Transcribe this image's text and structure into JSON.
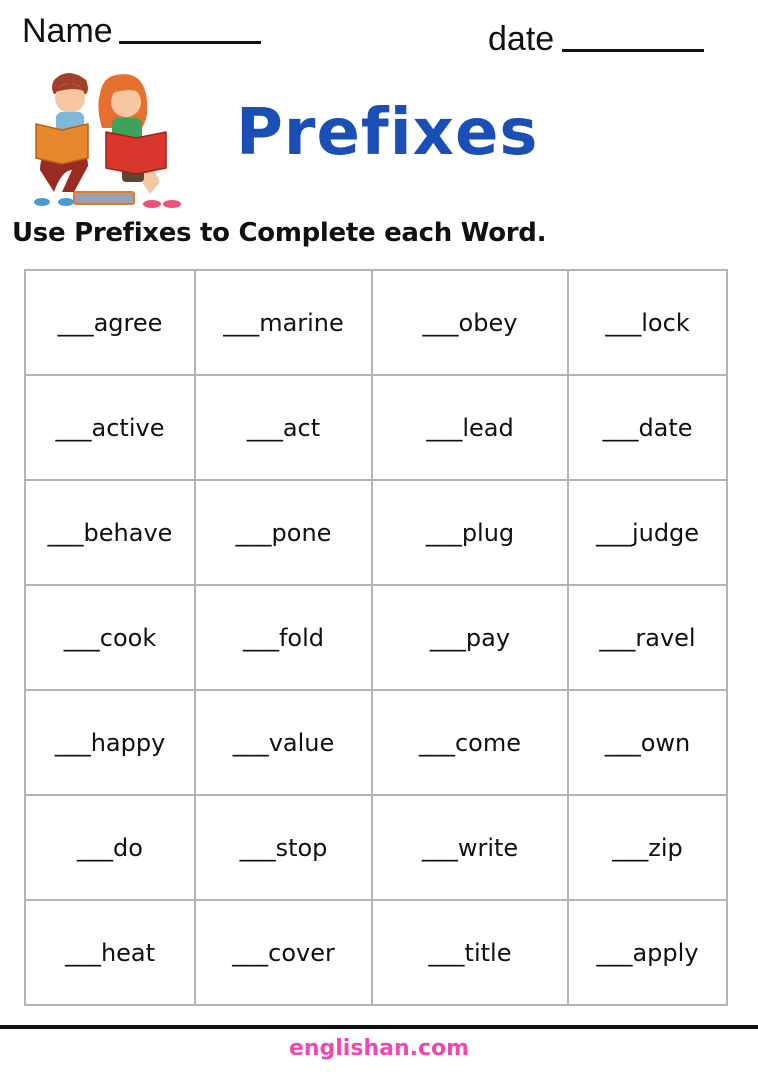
{
  "header": {
    "name_label": "Name",
    "date_label": "date",
    "title": "Prefixes",
    "illustration": "two-children-reading-books-illustration"
  },
  "instructions": "Use Prefixes to Complete each Word.",
  "colors": {
    "title": "#1a4fb5",
    "footer_link": "#f048b0",
    "grid_border": "#b3b3b3"
  },
  "grid": {
    "rows": [
      [
        "___agree",
        "___marine",
        "___obey",
        "___lock"
      ],
      [
        "___active",
        "___act",
        "___lead",
        "___date"
      ],
      [
        "___behave",
        "___pone",
        "___plug",
        "___judge"
      ],
      [
        "___cook",
        "___fold",
        "___pay",
        "___ravel"
      ],
      [
        "___happy",
        "___value",
        "___come",
        "___own"
      ],
      [
        "___do",
        "___stop",
        "___write",
        "___zip"
      ],
      [
        "___heat",
        "___cover",
        "___title",
        "___apply"
      ]
    ]
  },
  "footer": {
    "site": "englishan.com"
  }
}
